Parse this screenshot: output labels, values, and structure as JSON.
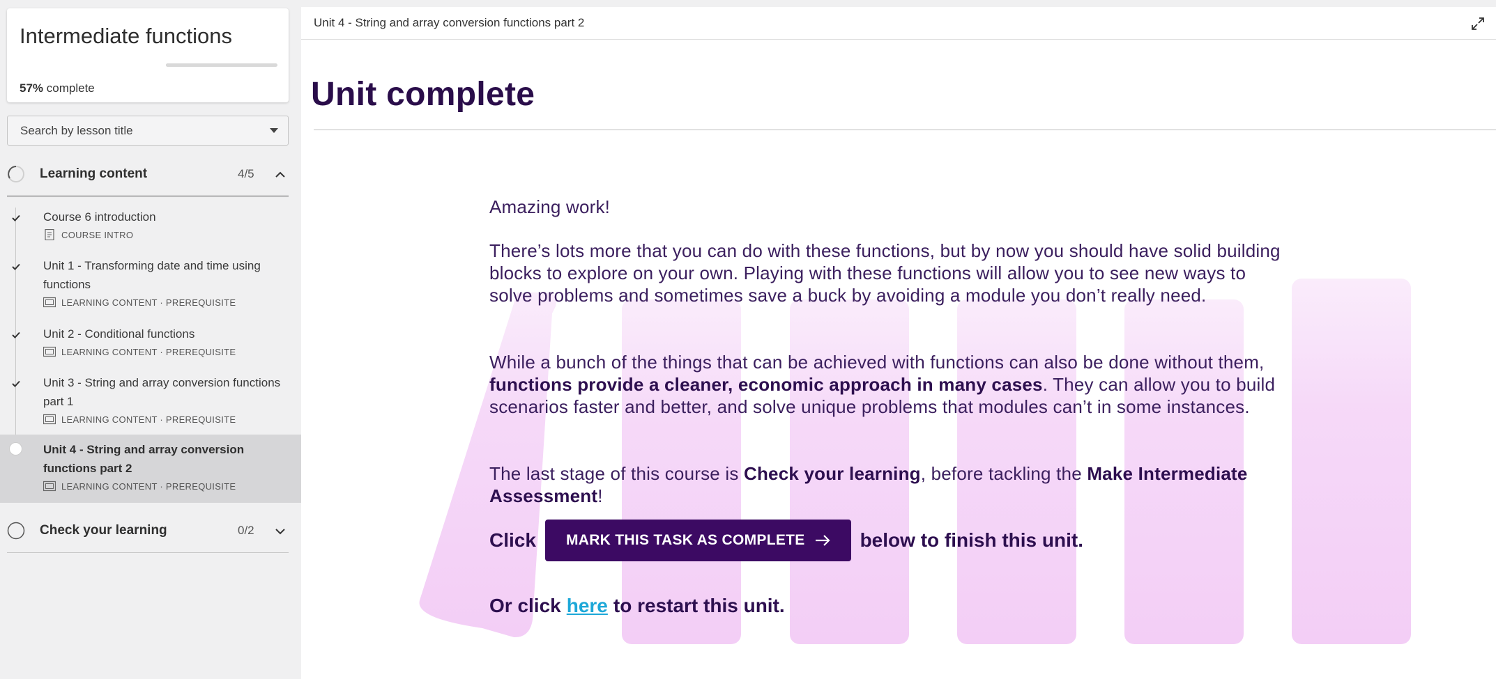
{
  "course": {
    "title": "Intermediate functions",
    "progress_value": "57%",
    "progress_suffix": "complete",
    "progress_fraction": 0.57
  },
  "search": {
    "placeholder": "Search by lesson title"
  },
  "sections": [
    {
      "title": "Learning content",
      "count": "4/5",
      "icon": "progress-ring-icon",
      "expanded": true
    },
    {
      "title": "Check your learning",
      "count": "0/2",
      "icon": "empty-circle-icon",
      "expanded": false
    }
  ],
  "lessons": [
    {
      "title": "Course 6 introduction",
      "meta": "COURSE INTRO",
      "status": "complete",
      "icon": "document-icon"
    },
    {
      "title": "Unit 1 - Transforming date and time using functions",
      "meta": "LEARNING CONTENT · PREREQUISITE",
      "status": "complete",
      "icon": "slides-icon"
    },
    {
      "title": "Unit 2 - Conditional functions",
      "meta": "LEARNING CONTENT · PREREQUISITE",
      "status": "complete",
      "icon": "slides-icon"
    },
    {
      "title": "Unit 3 - String and array conversion functions part 1",
      "meta": "LEARNING CONTENT · PREREQUISITE",
      "status": "complete",
      "icon": "slides-icon"
    },
    {
      "title": "Unit 4 - String and array conversion functions part 2",
      "meta": "LEARNING CONTENT · PREREQUISITE",
      "status": "current",
      "icon": "slides-icon"
    }
  ],
  "header": {
    "breadcrumb": "Unit 4 - String and array conversion functions part 2",
    "expand_icon": "expand-icon"
  },
  "main": {
    "page_title": "Unit complete",
    "p1": "Amazing work!",
    "p2": "There’s lots more that you can do with these functions, but by now you should have solid building blocks to explore on your own. Playing with these functions will allow you to see new ways to solve problems and sometimes save a buck by avoiding a module you don’t really need.",
    "p3_a": "While a bunch of the things that can be achieved with functions can also be done without them, ",
    "p3_b": "functions provide a cleaner, economic approach in many cases",
    "p3_c": ". They can allow you to build scenarios faster and better, and solve unique problems that modules can’t in some instances.",
    "p4_a": "The last stage of this course is ",
    "p4_b": "Check your learning",
    "p4_c": ", before tackling the ",
    "p4_d": "Make Intermediate Assessment",
    "p4_e": "!",
    "click_prefix": "Click",
    "cta_label": "MARK THIS TASK AS COMPLETE",
    "click_suffix": "below to finish this unit.",
    "restart_prefix": "Or click",
    "restart_link": "here",
    "restart_suffix": "to restart this unit."
  },
  "colors": {
    "accent": "#3c0a63",
    "heading": "#2a0d4a",
    "link": "#1da8d8",
    "art": "#f2c6f5"
  }
}
